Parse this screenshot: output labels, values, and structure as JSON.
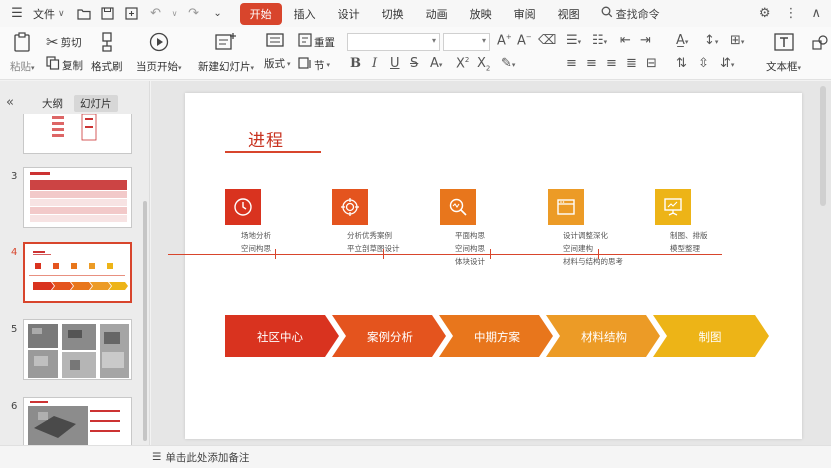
{
  "menubar": {
    "file_label": "文件",
    "tabs": [
      "开始",
      "插入",
      "设计",
      "切换",
      "动画",
      "放映",
      "审阅",
      "视图"
    ],
    "active_tab": "开始",
    "search_label": "查找命令"
  },
  "ribbon": {
    "paste_label": "粘贴",
    "cut_label": "剪切",
    "copy_label": "复制",
    "format_painter_label": "格式刷",
    "play_from_current_label": "当页开始",
    "new_slide_label": "新建幻灯片",
    "layout_label": "版式",
    "section_label": "节",
    "reset_label": "重置",
    "textbox_label": "文本框"
  },
  "left_panel": {
    "outline_tab": "大纲",
    "slides_tab": "幻灯片",
    "slide_numbers": [
      "3",
      "4",
      "5",
      "6"
    ],
    "selected_slide": "4"
  },
  "slide": {
    "title": "进程",
    "steps": [
      {
        "lines": [
          "场地分析",
          "空间构思"
        ],
        "color": "#d9331f",
        "icon": "clock-icon"
      },
      {
        "lines": [
          "分析优秀案例",
          "平立剖草图设计"
        ],
        "color": "#e4541e",
        "icon": "target-icon"
      },
      {
        "lines": [
          "平面构思",
          "空间构思",
          "体块设计"
        ],
        "color": "#e8761c",
        "icon": "magnifier-chart-icon"
      },
      {
        "lines": [
          "设计调整深化",
          "空间建构",
          "材料与结构的思考"
        ],
        "color": "#ec9b26",
        "icon": "browser-window-icon"
      },
      {
        "lines": [
          "制图、排版",
          "模型整理"
        ],
        "color": "#edb417",
        "icon": "presentation-board-icon"
      }
    ],
    "phases": [
      {
        "label": "社区中心",
        "color": "#d9331f"
      },
      {
        "label": "案例分析",
        "color": "#e4541e"
      },
      {
        "label": "中期方案",
        "color": "#e8761c"
      },
      {
        "label": "材料结构",
        "color": "#ec9b26"
      },
      {
        "label": "制图",
        "color": "#edb417"
      }
    ]
  },
  "notes_bar": {
    "placeholder": "单击此处添加备注"
  }
}
